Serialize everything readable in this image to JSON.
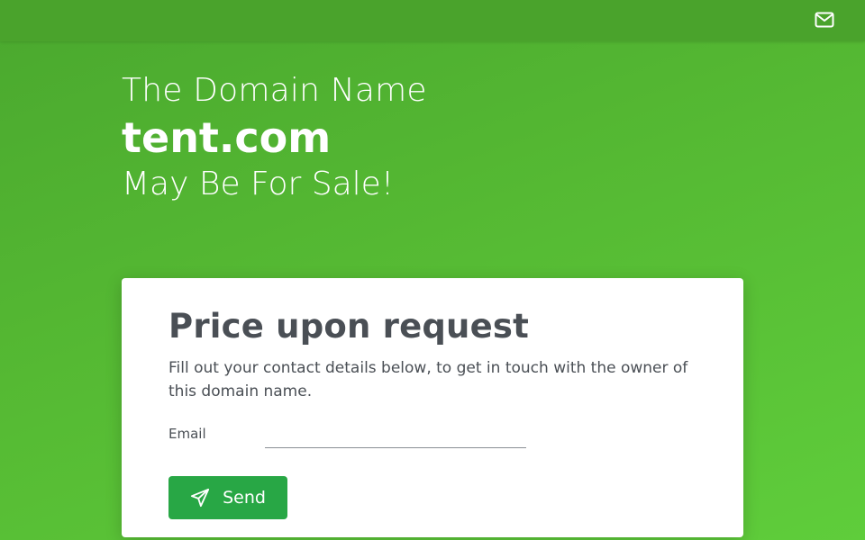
{
  "header": {
    "mail_icon": "envelope-icon"
  },
  "hero": {
    "line1": "The Domain Name",
    "domain": "tent.com",
    "line3": "May Be For Sale!"
  },
  "card": {
    "title": "Price upon request",
    "description": "Fill out your contact details below, to get in touch with the owner of this domain name.",
    "email_label": "Email",
    "email_value": "",
    "email_placeholder": "",
    "send_label": "Send",
    "send_icon": "paper-plane-icon"
  },
  "colors": {
    "background": "#55b933",
    "topbar": "#4aa32c",
    "button": "#28a745",
    "text_dark": "#4a4f55"
  }
}
